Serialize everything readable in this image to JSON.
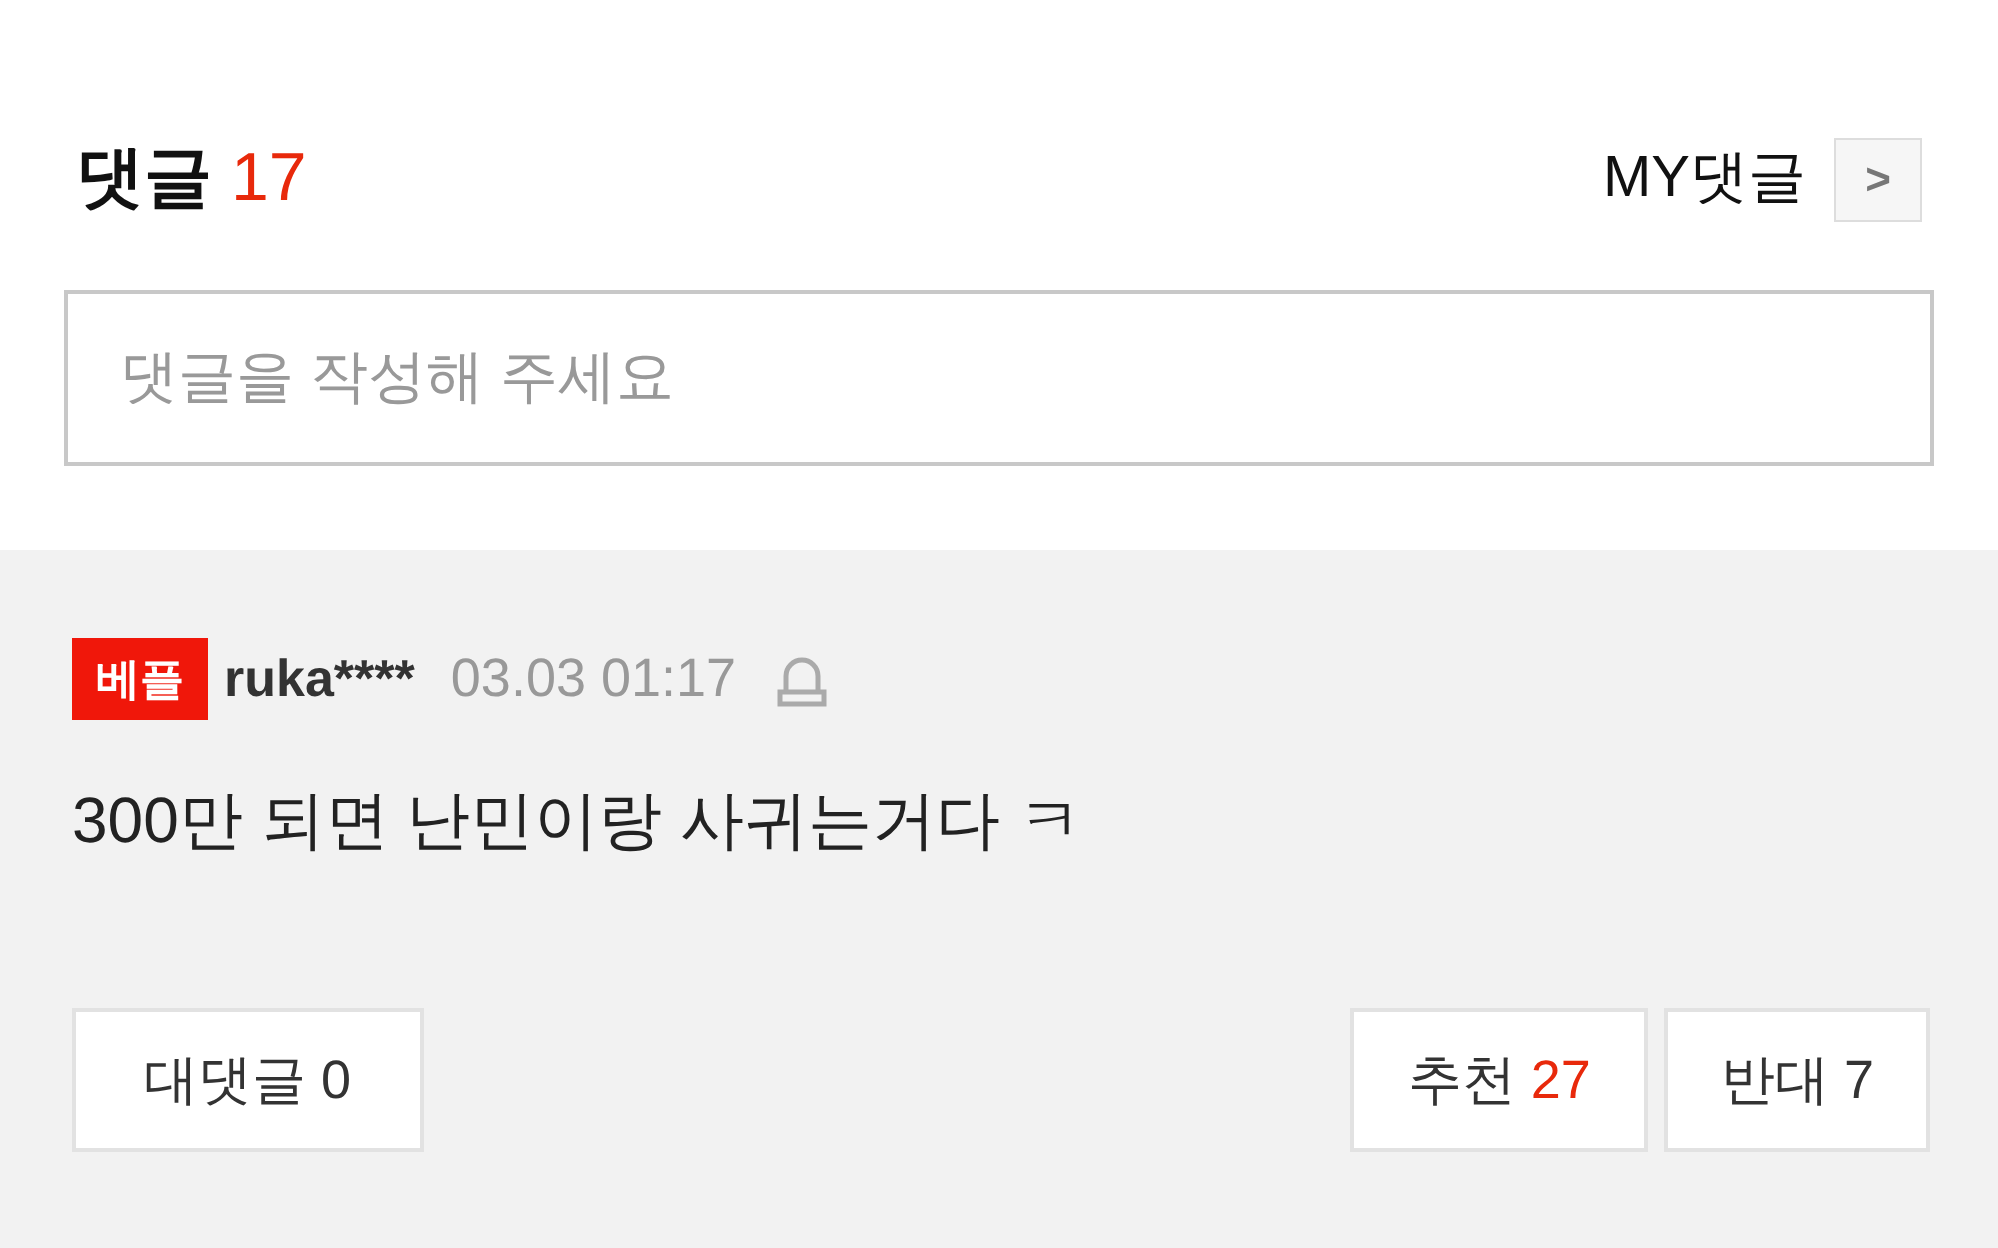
{
  "header": {
    "title": "댓글",
    "count": "17",
    "my_comments": "MY댓글",
    "arrow": ">"
  },
  "comment_input": {
    "placeholder": "댓글을 작성해 주세요"
  },
  "comments": [
    {
      "badge": "베플",
      "author": "ruka****",
      "time": "03.03 01:17",
      "text": "300만 되면 난민이랑 사귀는거다 ㅋ",
      "reply_label": "대댓글",
      "reply_count": "0",
      "like_label": "추천",
      "like_count": "27",
      "dislike_label": "반대",
      "dislike_count": "7"
    }
  ]
}
